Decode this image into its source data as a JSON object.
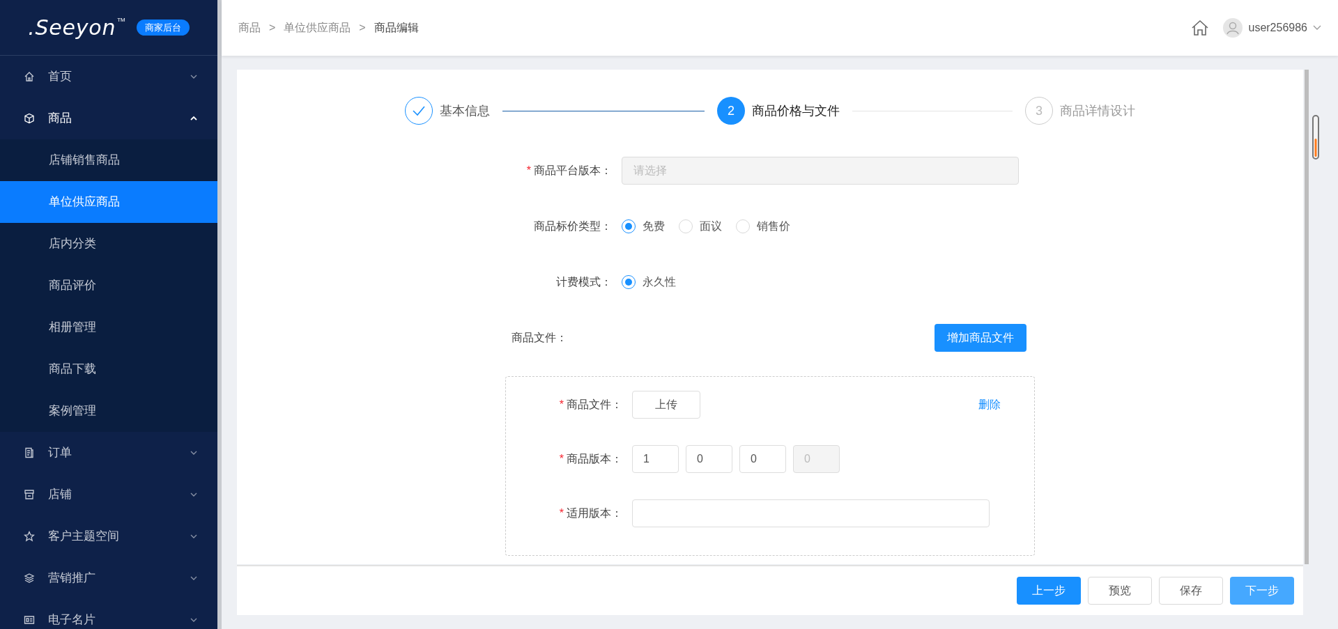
{
  "logo": {
    "brand": ".Seeyon",
    "trademark": "TM",
    "badge": "商家后台"
  },
  "sidebar": {
    "items": [
      {
        "label": "首页",
        "expanded": false
      },
      {
        "label": "商品",
        "expanded": true,
        "children": [
          {
            "label": "店铺销售商品",
            "selected": false
          },
          {
            "label": "单位供应商品",
            "selected": true
          },
          {
            "label": "店内分类",
            "selected": false
          },
          {
            "label": "商品评价",
            "selected": false
          },
          {
            "label": "相册管理",
            "selected": false
          },
          {
            "label": "商品下载",
            "selected": false
          },
          {
            "label": "案例管理",
            "selected": false
          }
        ]
      },
      {
        "label": "订单",
        "expanded": false
      },
      {
        "label": "店铺",
        "expanded": false
      },
      {
        "label": "客户主题空间",
        "expanded": false
      },
      {
        "label": "营销推广",
        "expanded": false
      },
      {
        "label": "电子名片",
        "expanded": false
      }
    ]
  },
  "header": {
    "breadcrumb": [
      {
        "label": "商品"
      },
      {
        "separator": ">",
        "label": "单位供应商品"
      },
      {
        "separator": ">",
        "label": "商品编辑"
      }
    ],
    "user": "user256986"
  },
  "steps": [
    {
      "title": "基本信息",
      "done": true,
      "selected": false
    },
    {
      "number": "2",
      "title": "商品价格与文件",
      "done": false,
      "selected": true
    },
    {
      "number": "3",
      "title": "商品详情设计",
      "done": false,
      "selected": false
    }
  ],
  "form": {
    "fields": [
      {
        "kind": "select",
        "label": "商品平台版本：",
        "required_mark": "*",
        "placeholder": "请选择",
        "disabled": true
      },
      {
        "kind": "radio",
        "label": "商品标价类型：",
        "options": [
          {
            "label": "免费",
            "selected": true
          },
          {
            "label": "面议",
            "selected": false
          },
          {
            "label": "销售价",
            "selected": false
          }
        ]
      },
      {
        "kind": "radio",
        "label": "计费模式：",
        "options": [
          {
            "label": "永久性",
            "selected": true
          }
        ]
      }
    ],
    "files": {
      "label": "商品文件：",
      "add_button": "增加商品文件",
      "items": [
        {
          "file_required_mark": "*",
          "file_label": "商品文件：",
          "upload_button": "上传",
          "delete_link": "删除",
          "version_required_mark": "*",
          "version_label": "商品版本：",
          "version_parts": [
            {
              "value": "1",
              "disabled": false
            },
            {
              "value": "0",
              "disabled": false
            },
            {
              "value": "0",
              "disabled": false
            },
            {
              "value": "0",
              "disabled": true
            }
          ],
          "applies_required_mark": "*",
          "applies_label": "适用版本："
        }
      ]
    }
  },
  "footer": {
    "buttons": [
      {
        "label": "上一步",
        "kind": "primary"
      },
      {
        "label": "预览",
        "kind": "default"
      },
      {
        "label": "保存",
        "kind": "default"
      },
      {
        "label": "下一步",
        "kind": "light"
      }
    ]
  }
}
